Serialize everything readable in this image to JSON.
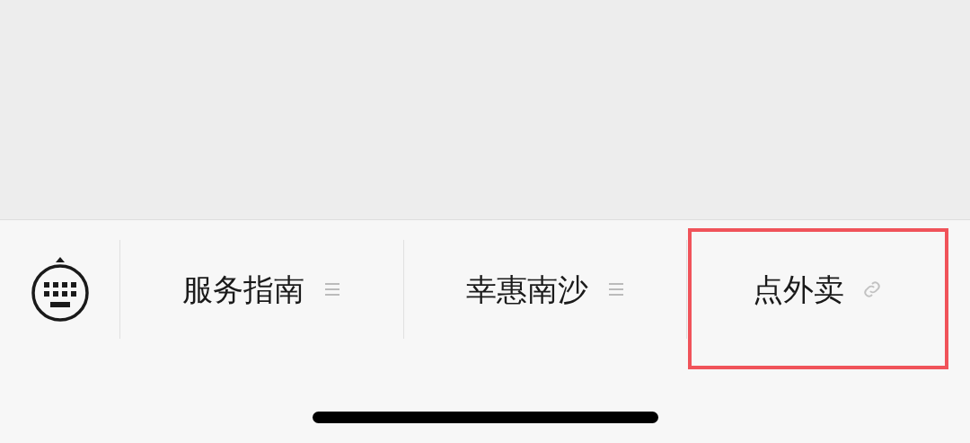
{
  "menu": {
    "items": [
      {
        "label": "服务指南",
        "kind": "submenu",
        "highlighted": false
      },
      {
        "label": "幸惠南沙",
        "kind": "submenu",
        "highlighted": false
      },
      {
        "label": "点外卖",
        "kind": "link",
        "highlighted": true
      }
    ]
  }
}
